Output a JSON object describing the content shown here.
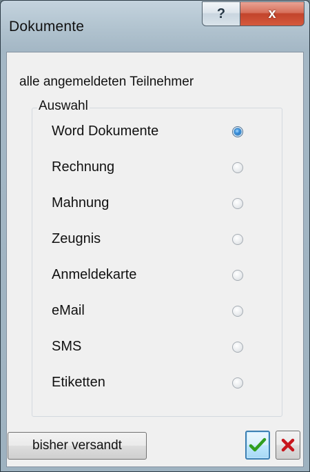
{
  "window": {
    "title": "Dokumente",
    "help_glyph": "?",
    "close_glyph": "x"
  },
  "subtitle": "alle angemeldeten Teilnehmer",
  "group": {
    "legend": "Auswahl",
    "options": [
      {
        "label": "Word Dokumente",
        "selected": true
      },
      {
        "label": "Rechnung",
        "selected": false
      },
      {
        "label": "Mahnung",
        "selected": false
      },
      {
        "label": "Zeugnis",
        "selected": false
      },
      {
        "label": "Anmeldekarte",
        "selected": false
      },
      {
        "label": "eMail",
        "selected": false
      },
      {
        "label": "SMS",
        "selected": false
      },
      {
        "label": "Etiketten",
        "selected": false
      }
    ]
  },
  "buttons": {
    "sent_label": "bisher versandt",
    "ok_icon": "green-checkmark-icon",
    "cancel_icon": "red-x-icon"
  },
  "colors": {
    "ok_check": "#2f9e1f",
    "cancel_x": "#c8161d",
    "selected_radio": "#2b7bc4"
  }
}
